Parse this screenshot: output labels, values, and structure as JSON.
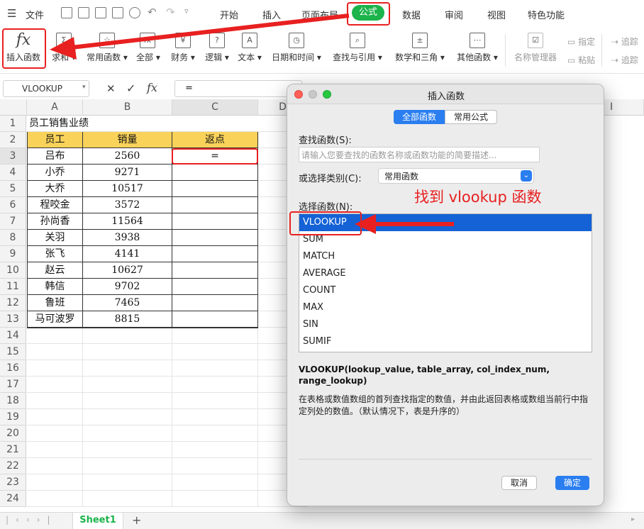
{
  "menu": {
    "items": [
      "文件",
      "开始",
      "插入",
      "页面布局",
      "公式",
      "数据",
      "审阅",
      "视图",
      "特色功能"
    ]
  },
  "ribbon": {
    "buttons": [
      "插入函数",
      "求和",
      "常用函数",
      "全部",
      "财务",
      "逻辑",
      "文本",
      "日期和时间",
      "查找与引用",
      "数学和三角",
      "其他函数",
      "名称管理器"
    ],
    "small": [
      "指定",
      "粘贴",
      "追踪",
      "追踪"
    ]
  },
  "formula_bar": {
    "name_box": "VLOOKUP",
    "cancel": "✕",
    "confirm": "✓",
    "fx": "fx",
    "content": "="
  },
  "grid": {
    "columns": [
      "A",
      "B",
      "C",
      "D",
      "I"
    ],
    "rows": [
      "1",
      "2",
      "3",
      "4",
      "5",
      "6",
      "7",
      "8",
      "9",
      "10",
      "11",
      "12",
      "13",
      "14",
      "15",
      "16",
      "17",
      "18",
      "19",
      "20",
      "21",
      "22",
      "23",
      "24"
    ],
    "title": "员工销售业绩",
    "headers": [
      "员工",
      "销量",
      "返点"
    ],
    "data": [
      [
        "吕布",
        "2560",
        "="
      ],
      [
        "小乔",
        "9271",
        ""
      ],
      [
        "大乔",
        "10517",
        ""
      ],
      [
        "程咬金",
        "3572",
        ""
      ],
      [
        "孙尚香",
        "11564",
        ""
      ],
      [
        "关羽",
        "3938",
        ""
      ],
      [
        "张飞",
        "4141",
        ""
      ],
      [
        "赵云",
        "10627",
        ""
      ],
      [
        "韩信",
        "9702",
        ""
      ],
      [
        "鲁班",
        "7465",
        ""
      ],
      [
        "马可波罗",
        "8815",
        ""
      ]
    ]
  },
  "sheets": [
    "Sheet1"
  ],
  "dialog": {
    "title": "插入函数",
    "tabs": [
      "全部函数",
      "常用公式"
    ],
    "search_label": "查找函数(S):",
    "search_placeholder": "请输入您要查找的函数名称或函数功能的简要描述...",
    "category_label": "或选择类别(C):",
    "category_value": "常用函数",
    "list_label": "选择函数(N):",
    "functions": [
      "VLOOKUP",
      "SUM",
      "MATCH",
      "AVERAGE",
      "COUNT",
      "MAX",
      "SIN",
      "SUMIF"
    ],
    "selected_index": 0,
    "signature": "VLOOKUP(lookup_value, table_array, col_index_num, range_lookup)",
    "description": "在表格或数值数组的首列查找指定的数值，并由此返回表格或数组当前行中指定列处的数值。（默认情况下，表是升序的）",
    "cancel": "取消",
    "ok": "确定"
  },
  "annotation": "找到 vlookup 函数",
  "colors": {
    "accent": "#1bb34a",
    "selection": "#1462d6",
    "highlight": "#f9d25a",
    "annotation": "#e82020"
  }
}
